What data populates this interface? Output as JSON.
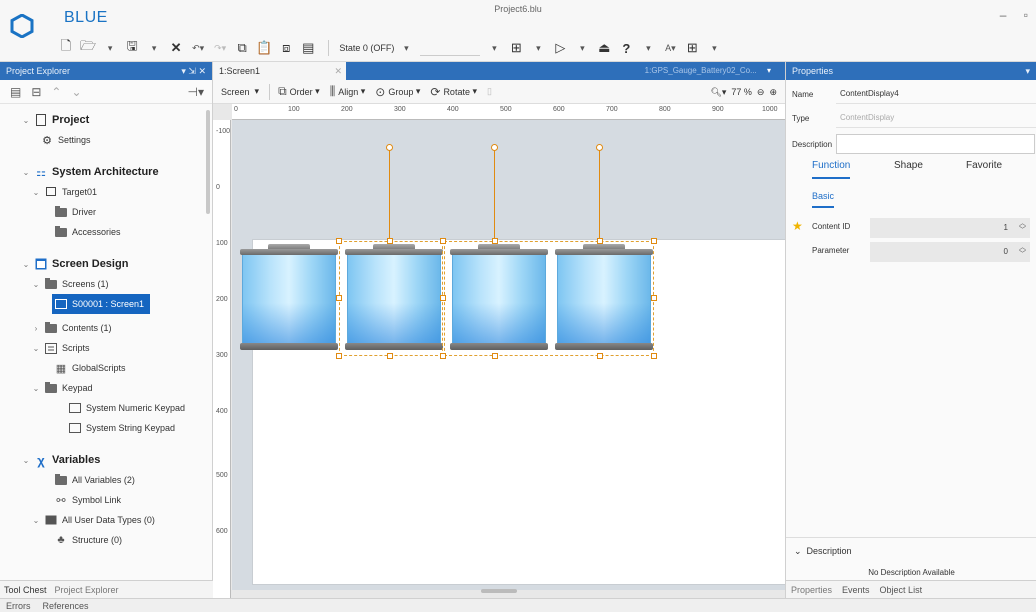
{
  "app": {
    "name": "BLUE",
    "window_title": "Project6.blu",
    "minimize": "–",
    "restore": "▫"
  },
  "toolbar": {
    "state_label": "State 0 (OFF)"
  },
  "left_panel": {
    "header": "Project Explorer",
    "header_ctrls": "▾ ⇲ ✕",
    "tree": [
      {
        "label": "Project",
        "section": true
      },
      {
        "label": "Settings"
      },
      {
        "label": "System Architecture",
        "section": true
      },
      {
        "label": "Target01"
      },
      {
        "label": "Driver"
      },
      {
        "label": "Accessories"
      },
      {
        "label": "Screen Design",
        "section": true
      },
      {
        "label": "Screens (1)"
      },
      {
        "label": "S00001 : Screen1",
        "selected": true
      },
      {
        "label": "Contents (1)"
      },
      {
        "label": "Scripts"
      },
      {
        "label": "GlobalScripts"
      },
      {
        "label": "Keypad"
      },
      {
        "label": "System Numeric Keypad"
      },
      {
        "label": "System String Keypad"
      },
      {
        "label": "Variables",
        "section": true
      },
      {
        "label": "All Variables (2)"
      },
      {
        "label": "Symbol Link"
      },
      {
        "label": "All User Data Types (0)"
      },
      {
        "label": "Structure (0)"
      }
    ],
    "bottom_tabs": [
      "Tool Chest",
      "Project Explorer"
    ]
  },
  "center": {
    "doc_tab": "1:Screen1",
    "ghost_tab": "1:GPS_Gauge_Battery02_Co...",
    "tools": {
      "screen": "Screen",
      "order": "Order",
      "align": "Align",
      "group": "Group",
      "rotate": "Rotate",
      "zoom": "77 %"
    },
    "ruler_h": [
      "0",
      "100",
      "200",
      "300",
      "400",
      "500",
      "600",
      "700",
      "800",
      "900",
      "1000"
    ],
    "ruler_v": [
      "-100",
      "0",
      "100",
      "200",
      "300",
      "400",
      "500",
      "600"
    ]
  },
  "properties": {
    "header": "Properties",
    "name_label": "Name",
    "name_value": "ContentDisplay4",
    "type_label": "Type",
    "type_value": "ContentDisplay",
    "description_label": "Description",
    "tabs": [
      "Function",
      "Shape",
      "Favorite"
    ],
    "subtab": "Basic",
    "content_id_label": "Content ID",
    "content_id_value": "1",
    "parameter_label": "Parameter",
    "parameter_value": "0",
    "desc_section": "Description",
    "desc_body": "No Description Available",
    "bottom_tabs": [
      "Properties",
      "Events",
      "Object List"
    ]
  },
  "bottom_bar": [
    "Errors",
    "References"
  ],
  "colors": {
    "accent": "#2e6fba",
    "selection": "#1565c0",
    "handle": "#e08a10"
  }
}
